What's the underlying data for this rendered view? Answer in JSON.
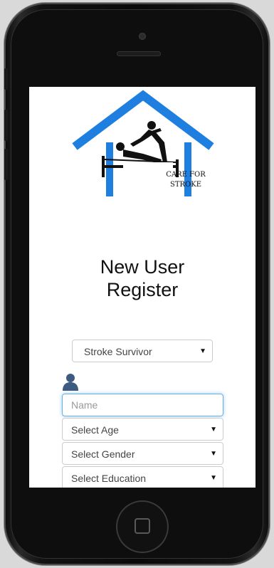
{
  "logo": {
    "line1": "CARE FOR",
    "line2": "STROKE",
    "roof_color": "#1e7fe0"
  },
  "title": {
    "line1": "New User",
    "line2": "Register"
  },
  "user_type": {
    "selected": "Stroke Survivor"
  },
  "form": {
    "name_placeholder": "Name",
    "age": "Select Age",
    "gender": "Select Gender",
    "education": "Select Education"
  },
  "icons": {
    "user": "user-icon",
    "caret": "caret-down-icon"
  }
}
